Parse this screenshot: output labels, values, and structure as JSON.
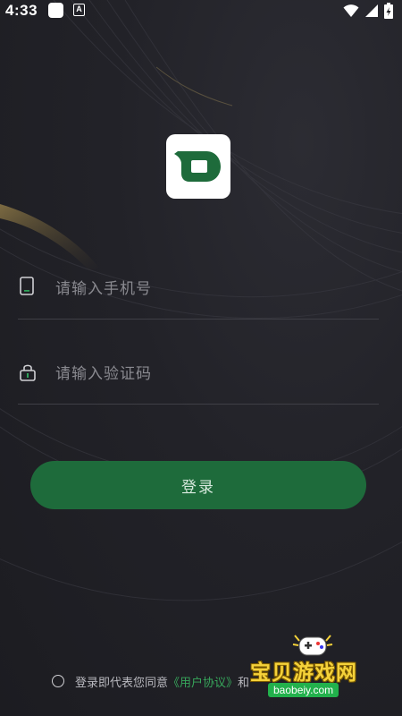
{
  "status_bar": {
    "time": "4:33",
    "notification_letter": "A",
    "icons": [
      "wifi-icon",
      "cellular-signal-icon",
      "battery-charging-icon"
    ]
  },
  "app": {
    "logo_icon": "app-logo-icon",
    "brand_color": "#1e6b3b"
  },
  "form": {
    "phone_placeholder": "请输入手机号",
    "code_placeholder": "请输入验证码",
    "phone_icon": "phone-icon",
    "code_icon": "lock-icon"
  },
  "login_button": {
    "label": "登录"
  },
  "agreement": {
    "prefix": "登录即代表您同意",
    "user_agreement_link": "《用户协议》",
    "connector": "和"
  },
  "watermark": {
    "text": "宝贝游戏网",
    "url": "baobeiy.com"
  }
}
